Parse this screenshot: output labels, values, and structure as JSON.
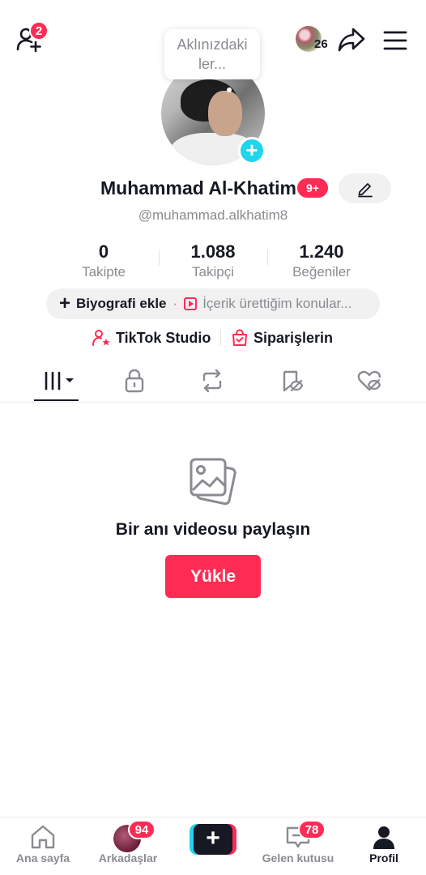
{
  "header": {
    "add_friend_badge": "2",
    "story_count": "26",
    "share_icon": "share-arrow-icon",
    "menu_icon": "hamburger-icon"
  },
  "bubble": {
    "text_line1": "Aklınızdaki",
    "text_line2": "ler..."
  },
  "profile": {
    "name": "Muhammad Al-Khatim",
    "name_badge": "9+",
    "username": "@muhammad.alkhatim8"
  },
  "stats": [
    {
      "value": "0",
      "label": "Takipte"
    },
    {
      "value": "1.088",
      "label": "Takipçi"
    },
    {
      "value": "1.240",
      "label": "Beğeniler"
    }
  ],
  "bio": {
    "add_label": "Biyografi ekle",
    "separator": "·",
    "topic_label": "İçerik ürettiğim konular..."
  },
  "links": {
    "studio_label": "TikTok Studio",
    "orders_label": "Siparişlerin"
  },
  "tabs": [
    {
      "icon": "grid-icon",
      "active": true
    },
    {
      "icon": "lock-icon",
      "active": false
    },
    {
      "icon": "repost-icon",
      "active": false
    },
    {
      "icon": "saved-hidden-icon",
      "active": false
    },
    {
      "icon": "liked-hidden-icon",
      "active": false
    }
  ],
  "empty_state": {
    "title": "Bir anı videosu paylaşın",
    "button": "Yükle"
  },
  "bottom_nav": {
    "home": "Ana sayfa",
    "friends": "Arkadaşlar",
    "friends_badge": "94",
    "inbox": "Gelen kutusu",
    "inbox_badge": "78",
    "profile": "Profil"
  },
  "colors": {
    "accent": "#fe2c55",
    "cyan": "#20d5ec",
    "text": "#161823",
    "muted": "#8a8b91"
  }
}
